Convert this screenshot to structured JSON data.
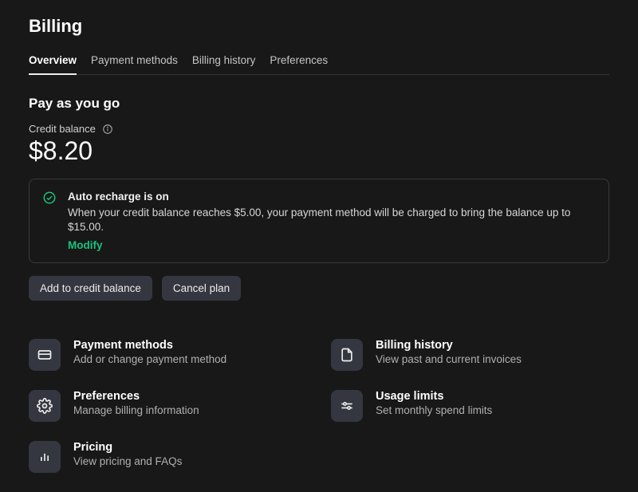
{
  "header": {
    "title": "Billing"
  },
  "tabs": [
    "Overview",
    "Payment methods",
    "Billing history",
    "Preferences"
  ],
  "section": {
    "title": "Pay as you go"
  },
  "balance": {
    "label": "Credit balance",
    "amount": "$8.20"
  },
  "notice": {
    "title": "Auto recharge is on",
    "body": "When your credit balance reaches $5.00, your payment method will be charged to bring the balance up to $15.00.",
    "action": "Modify"
  },
  "actions": {
    "add": "Add to credit balance",
    "cancel": "Cancel plan"
  },
  "cards": {
    "payment": {
      "title": "Payment methods",
      "desc": "Add or change payment method"
    },
    "history": {
      "title": "Billing history",
      "desc": "View past and current invoices"
    },
    "prefs": {
      "title": "Preferences",
      "desc": "Manage billing information"
    },
    "limits": {
      "title": "Usage limits",
      "desc": "Set monthly spend limits"
    },
    "pricing": {
      "title": "Pricing",
      "desc": "View pricing and FAQs"
    }
  }
}
